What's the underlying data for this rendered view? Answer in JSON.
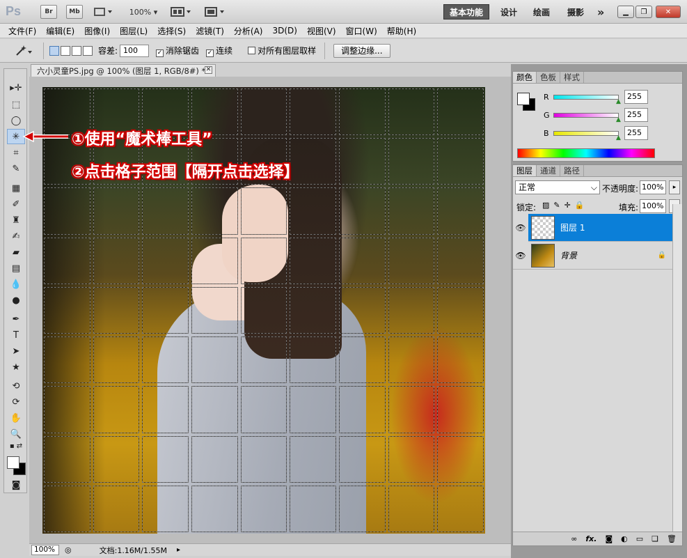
{
  "app": {
    "logo": "Ps",
    "zoom": "100%"
  },
  "titlebar": {
    "br": "Br",
    "mb": "Mb",
    "workspaces": [
      "基本功能",
      "设计",
      "绘画",
      "摄影"
    ],
    "more": "»"
  },
  "menu": [
    "文件(F)",
    "编辑(E)",
    "图像(I)",
    "图层(L)",
    "选择(S)",
    "滤镜(T)",
    "分析(A)",
    "3D(D)",
    "视图(V)",
    "窗口(W)",
    "帮助(H)"
  ],
  "options": {
    "tolerance_label": "容差:",
    "tolerance_value": "100",
    "antialias_label": "消除锯齿",
    "contiguous_label": "连续",
    "sample_all_label": "对所有图层取样",
    "refine_edge_label": "调整边缘..."
  },
  "document": {
    "tab_title": "六小灵童PS.jpg @ 100% (图层 1, RGB/8#) *",
    "grid": {
      "columns": 9,
      "rows": 9
    }
  },
  "status": {
    "zoom": "100%",
    "doc_info": "文档:1.16M/1.55M"
  },
  "color_panel": {
    "tabs": [
      "颜色",
      "色板",
      "样式"
    ],
    "channels": [
      {
        "label": "R",
        "value": "255",
        "color": "#00d8e0"
      },
      {
        "label": "G",
        "value": "255",
        "color": "#e000e0"
      },
      {
        "label": "B",
        "value": "255",
        "color": "#e8e800"
      }
    ]
  },
  "layers_panel": {
    "tabs": [
      "图层",
      "通道",
      "路径"
    ],
    "blend_mode": "正常",
    "opacity_label": "不透明度:",
    "opacity_value": "100%",
    "lock_label": "锁定:",
    "fill_label": "填充:",
    "fill_value": "100%",
    "layers": [
      {
        "name": "图层 1",
        "selected": true
      },
      {
        "name": "背景",
        "selected": false
      }
    ],
    "bottom_icons": [
      "link-icon",
      "fx-icon",
      "mask-icon",
      "adjustment-icon",
      "group-icon",
      "new-layer-icon",
      "trash-icon"
    ],
    "fx": "fx."
  },
  "annotations": {
    "step1": "①使用“魔术棒工具”",
    "step2": "②点击格子范围【隔开点击选择】"
  },
  "colors": {
    "accent": "#0b7fd8",
    "annotation": "#d10000"
  }
}
